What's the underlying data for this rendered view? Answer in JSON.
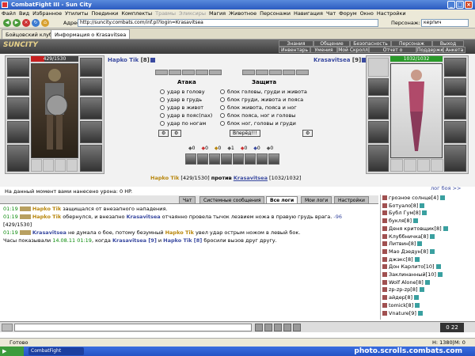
{
  "window": {
    "title": "CombatFight III - Sun City"
  },
  "menu": [
    "Файл",
    "Вид",
    "Избранное",
    "Утилиты",
    "Поединки",
    "Комплекты",
    "Травмы",
    "Эликсиры",
    "Магия",
    "Животное",
    "Персонажи",
    "Навигация",
    "Чат",
    "Форум",
    "Окно",
    "Настройки"
  ],
  "menu_disabled": [
    "Травмы",
    "Эликсиры"
  ],
  "toolbar": {
    "address_label": "Адрес:",
    "address_value": "http://suncity.combats.com/inf.pl?login=Krasavitsea",
    "person_label": "Персонаж:",
    "person_value": "керпич"
  },
  "browser_tabs": [
    {
      "label": "Бойцовский клуб",
      "active": false
    },
    {
      "label": "Информация о Krasavitsea",
      "active": true
    }
  ],
  "game_header": {
    "logo": "SUNCITY",
    "nav_top": [
      "Знания",
      "Общение",
      "Безопасность",
      "Персонаж",
      "Выход"
    ],
    "nav_bottom": [
      "Инвентарь",
      "Умения",
      "Мой Скролл",
      "Отчет о переводах",
      "Поддержка",
      "Анкета"
    ]
  },
  "fighter_left": {
    "name": "Hapko Tik",
    "level": "[8]",
    "hp": "429/1530",
    "hp_fraction": 0.28
  },
  "fighter_right": {
    "name": "Krasavitsea",
    "level": "[9]",
    "hp": "1032/1032",
    "hp_fraction": 1.0
  },
  "combat": {
    "attack_title": "Атака",
    "defense_title": "Защита",
    "attack_options": [
      "удар в голову",
      "удар в грудь",
      "удар в живот",
      "удар в пояс(пах)",
      "удар по ногам"
    ],
    "defense_options": [
      "блок головы, груди и живота",
      "блок груди, живота и пояса",
      "блок живота, пояса и ног",
      "блок пояса, ног и головы",
      "блок ног, головы и груди"
    ],
    "forward_button": "Вперёд!!!",
    "counters": [
      "0",
      "0",
      "0",
      "1",
      "0",
      "0",
      "0"
    ]
  },
  "vs_line": {
    "left": "Hapko Tik",
    "left_hp": "[429/1530]",
    "middle": "против",
    "right": "Krasavitsea",
    "right_hp": "[1032/1032]"
  },
  "damage_text": "На данный момент вами нанесено урона: 0 HP.",
  "log_toggle": "лог боя >>",
  "chat_tabs": [
    {
      "label": "Чат",
      "active": false
    },
    {
      "label": "Системные сообщения",
      "active": false
    },
    {
      "label": "Все логи",
      "active": true
    },
    {
      "label": "Мои логи",
      "active": false
    },
    {
      "label": "Настройки",
      "active": false
    }
  ],
  "chat": [
    {
      "time": "01:19",
      "parts": [
        {
          "t": "nm",
          "v": "Hapko Tik"
        },
        {
          "t": "",
          "v": " защищался от внезапного нападения."
        }
      ]
    },
    {
      "time": "01:19",
      "parts": [
        {
          "t": "nm",
          "v": "Hapko Tik"
        },
        {
          "t": "",
          "v": " обернулся, и внезапно "
        },
        {
          "t": "nm2",
          "v": "Krasavitsea"
        },
        {
          "t": "",
          "v": " отчаянно провела тычок лезвием ножа в правую грудь врага. "
        },
        {
          "t": "num",
          "v": "-96"
        }
      ]
    },
    {
      "time": "",
      "parts": [
        {
          "t": "",
          "v": "[429/1530]"
        }
      ]
    },
    {
      "time": "01:19",
      "parts": [
        {
          "t": "nm2",
          "v": "Krasavitsea"
        },
        {
          "t": "",
          "v": " не думала о бое, потому безумный "
        },
        {
          "t": "nm",
          "v": "Hapko Tik"
        },
        {
          "t": "",
          "v": " увел удар острым ножом в левый бок."
        }
      ]
    },
    {
      "time": "",
      "parts": [
        {
          "t": "",
          "v": "Часы показывали "
        },
        {
          "t": "time",
          "v": "14.08.11 01:19"
        },
        {
          "t": "",
          "v": ", когда "
        },
        {
          "t": "nm2",
          "v": "Krasavitsea [9]"
        },
        {
          "t": "",
          "v": " и "
        },
        {
          "t": "nm2",
          "v": "Hapko Tik [8]"
        },
        {
          "t": "",
          "v": " бросили вызов друг другу."
        }
      ]
    }
  ],
  "users": [
    "грозное солнце[4]",
    "Ботуало[8]",
    "Бубл Гум[8]",
    "букля[8]",
    "Деня критовщик[8]",
    "Клуббничка[8]",
    "Литвин[8]",
    "Мао Дзедун[8]",
    "джэкс[8]",
    "Дон Карлито[10]",
    "Заклинанный[10]",
    "Wolf Alone[8]",
    "zp-zp-zp[8]",
    "айдер[8]",
    "tomick[8]",
    "Vnature[9]"
  ],
  "clock": "0 22",
  "status": {
    "left": "Готово",
    "right": "Н: 1380|М: 0"
  },
  "taskbar": {
    "task": "CombatFight",
    "watermark": "photo.scrolls.combats.com"
  }
}
